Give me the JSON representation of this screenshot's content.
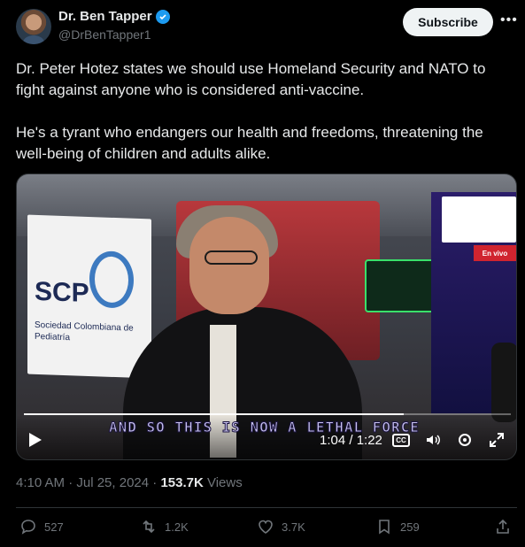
{
  "author": {
    "name": "Dr. Ben Tapper",
    "handle": "@DrBenTapper1",
    "verified": true
  },
  "subscribe_label": "Subscribe",
  "tweet": {
    "paragraphs": [
      "Dr. Peter Hotez states we should use Homeland Security and NATO to fight against anyone who is considered anti-vaccine.",
      "He's a tyrant who endangers our health and freedoms, threatening the well-being of children and adults alike."
    ]
  },
  "video": {
    "caption": "AND SO THIS IS NOW A LETHAL FORCE",
    "time": "1:04 / 1:22",
    "progress": 0.78,
    "sign_big": "SCP",
    "sign_small": "Sociedad Colombiana de Pediatría",
    "live_badge": "En vivo"
  },
  "meta": {
    "time": "4:10 AM · Jul 25, 2024 · ",
    "views_count": "153.7K",
    "views_label": " Views"
  },
  "actions": {
    "replies": "527",
    "reposts": "1.2K",
    "likes": "3.7K",
    "bookmarks": "259"
  },
  "colors": {
    "accent": "#1d9bf0",
    "muted": "#71767b",
    "background": "#000000"
  }
}
